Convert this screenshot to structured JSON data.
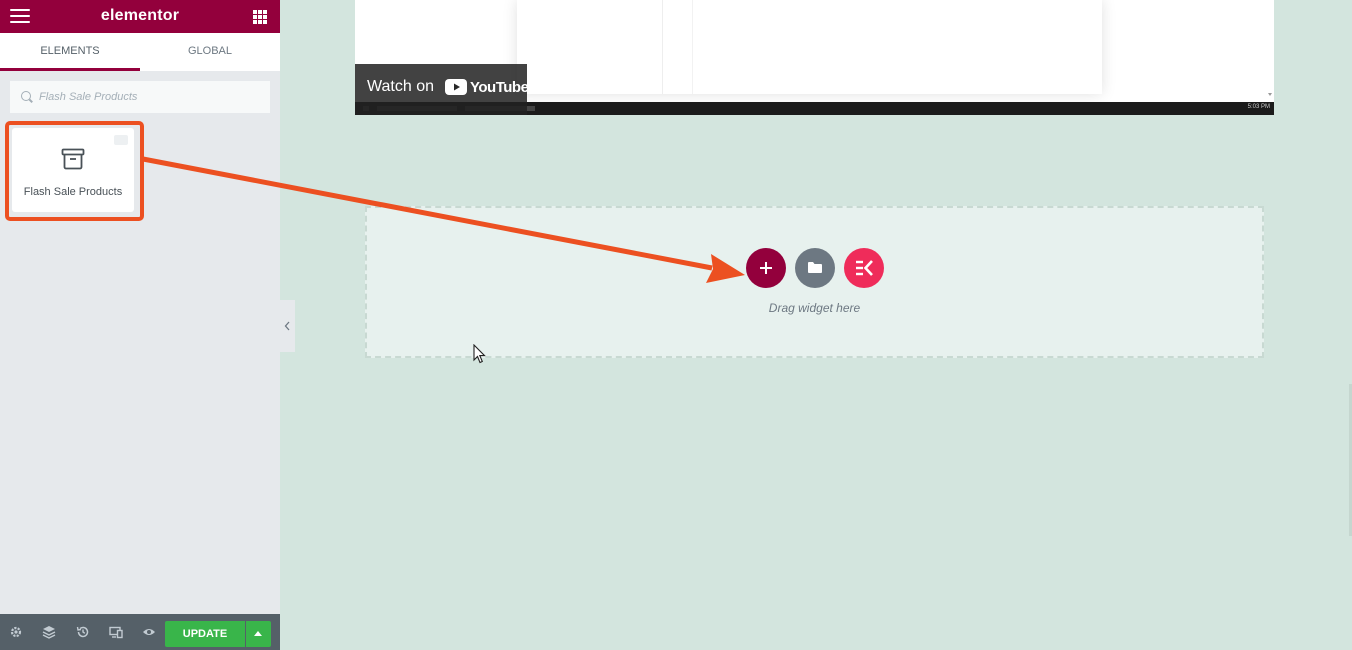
{
  "sidebar": {
    "logo": "elementor",
    "tabs": [
      {
        "label": "ELEMENTS"
      },
      {
        "label": "GLOBAL"
      }
    ],
    "search": {
      "placeholder": "Flash Sale Products"
    },
    "widget": {
      "label": "Flash Sale Products",
      "icon": "archive-box-icon"
    },
    "bottom_bar": {
      "icons": [
        "settings-icon",
        "layers-icon",
        "history-icon",
        "responsive-icon",
        "preview-icon"
      ],
      "update_label": "UPDATE"
    }
  },
  "canvas": {
    "video": {
      "watch_label": "Watch on",
      "youtube_label": "YouTube",
      "taskbar_time": "5:03 PM"
    },
    "dropzone": {
      "drag_text": "Drag widget here"
    }
  },
  "colors": {
    "brand": "#93003c",
    "highlight": "#ec5021",
    "update": "#39b54a",
    "ek": "#ef2c5a",
    "canvas_bg": "#d3e5de"
  }
}
